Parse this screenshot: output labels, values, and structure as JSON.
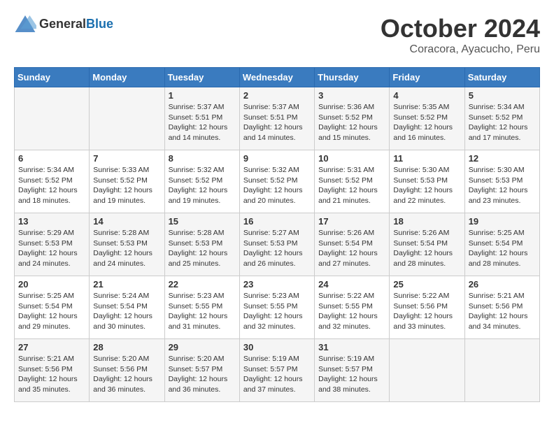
{
  "header": {
    "logo_general": "General",
    "logo_blue": "Blue",
    "month_title": "October 2024",
    "subtitle": "Coracora, Ayacucho, Peru"
  },
  "weekdays": [
    "Sunday",
    "Monday",
    "Tuesday",
    "Wednesday",
    "Thursday",
    "Friday",
    "Saturday"
  ],
  "weeks": [
    [
      {
        "day": "",
        "sunrise": "",
        "sunset": "",
        "daylight": ""
      },
      {
        "day": "",
        "sunrise": "",
        "sunset": "",
        "daylight": ""
      },
      {
        "day": "1",
        "sunrise": "Sunrise: 5:37 AM",
        "sunset": "Sunset: 5:51 PM",
        "daylight": "Daylight: 12 hours and 14 minutes."
      },
      {
        "day": "2",
        "sunrise": "Sunrise: 5:37 AM",
        "sunset": "Sunset: 5:51 PM",
        "daylight": "Daylight: 12 hours and 14 minutes."
      },
      {
        "day": "3",
        "sunrise": "Sunrise: 5:36 AM",
        "sunset": "Sunset: 5:52 PM",
        "daylight": "Daylight: 12 hours and 15 minutes."
      },
      {
        "day": "4",
        "sunrise": "Sunrise: 5:35 AM",
        "sunset": "Sunset: 5:52 PM",
        "daylight": "Daylight: 12 hours and 16 minutes."
      },
      {
        "day": "5",
        "sunrise": "Sunrise: 5:34 AM",
        "sunset": "Sunset: 5:52 PM",
        "daylight": "Daylight: 12 hours and 17 minutes."
      }
    ],
    [
      {
        "day": "6",
        "sunrise": "Sunrise: 5:34 AM",
        "sunset": "Sunset: 5:52 PM",
        "daylight": "Daylight: 12 hours and 18 minutes."
      },
      {
        "day": "7",
        "sunrise": "Sunrise: 5:33 AM",
        "sunset": "Sunset: 5:52 PM",
        "daylight": "Daylight: 12 hours and 19 minutes."
      },
      {
        "day": "8",
        "sunrise": "Sunrise: 5:32 AM",
        "sunset": "Sunset: 5:52 PM",
        "daylight": "Daylight: 12 hours and 19 minutes."
      },
      {
        "day": "9",
        "sunrise": "Sunrise: 5:32 AM",
        "sunset": "Sunset: 5:52 PM",
        "daylight": "Daylight: 12 hours and 20 minutes."
      },
      {
        "day": "10",
        "sunrise": "Sunrise: 5:31 AM",
        "sunset": "Sunset: 5:52 PM",
        "daylight": "Daylight: 12 hours and 21 minutes."
      },
      {
        "day": "11",
        "sunrise": "Sunrise: 5:30 AM",
        "sunset": "Sunset: 5:53 PM",
        "daylight": "Daylight: 12 hours and 22 minutes."
      },
      {
        "day": "12",
        "sunrise": "Sunrise: 5:30 AM",
        "sunset": "Sunset: 5:53 PM",
        "daylight": "Daylight: 12 hours and 23 minutes."
      }
    ],
    [
      {
        "day": "13",
        "sunrise": "Sunrise: 5:29 AM",
        "sunset": "Sunset: 5:53 PM",
        "daylight": "Daylight: 12 hours and 24 minutes."
      },
      {
        "day": "14",
        "sunrise": "Sunrise: 5:28 AM",
        "sunset": "Sunset: 5:53 PM",
        "daylight": "Daylight: 12 hours and 24 minutes."
      },
      {
        "day": "15",
        "sunrise": "Sunrise: 5:28 AM",
        "sunset": "Sunset: 5:53 PM",
        "daylight": "Daylight: 12 hours and 25 minutes."
      },
      {
        "day": "16",
        "sunrise": "Sunrise: 5:27 AM",
        "sunset": "Sunset: 5:53 PM",
        "daylight": "Daylight: 12 hours and 26 minutes."
      },
      {
        "day": "17",
        "sunrise": "Sunrise: 5:26 AM",
        "sunset": "Sunset: 5:54 PM",
        "daylight": "Daylight: 12 hours and 27 minutes."
      },
      {
        "day": "18",
        "sunrise": "Sunrise: 5:26 AM",
        "sunset": "Sunset: 5:54 PM",
        "daylight": "Daylight: 12 hours and 28 minutes."
      },
      {
        "day": "19",
        "sunrise": "Sunrise: 5:25 AM",
        "sunset": "Sunset: 5:54 PM",
        "daylight": "Daylight: 12 hours and 28 minutes."
      }
    ],
    [
      {
        "day": "20",
        "sunrise": "Sunrise: 5:25 AM",
        "sunset": "Sunset: 5:54 PM",
        "daylight": "Daylight: 12 hours and 29 minutes."
      },
      {
        "day": "21",
        "sunrise": "Sunrise: 5:24 AM",
        "sunset": "Sunset: 5:54 PM",
        "daylight": "Daylight: 12 hours and 30 minutes."
      },
      {
        "day": "22",
        "sunrise": "Sunrise: 5:23 AM",
        "sunset": "Sunset: 5:55 PM",
        "daylight": "Daylight: 12 hours and 31 minutes."
      },
      {
        "day": "23",
        "sunrise": "Sunrise: 5:23 AM",
        "sunset": "Sunset: 5:55 PM",
        "daylight": "Daylight: 12 hours and 32 minutes."
      },
      {
        "day": "24",
        "sunrise": "Sunrise: 5:22 AM",
        "sunset": "Sunset: 5:55 PM",
        "daylight": "Daylight: 12 hours and 32 minutes."
      },
      {
        "day": "25",
        "sunrise": "Sunrise: 5:22 AM",
        "sunset": "Sunset: 5:56 PM",
        "daylight": "Daylight: 12 hours and 33 minutes."
      },
      {
        "day": "26",
        "sunrise": "Sunrise: 5:21 AM",
        "sunset": "Sunset: 5:56 PM",
        "daylight": "Daylight: 12 hours and 34 minutes."
      }
    ],
    [
      {
        "day": "27",
        "sunrise": "Sunrise: 5:21 AM",
        "sunset": "Sunset: 5:56 PM",
        "daylight": "Daylight: 12 hours and 35 minutes."
      },
      {
        "day": "28",
        "sunrise": "Sunrise: 5:20 AM",
        "sunset": "Sunset: 5:56 PM",
        "daylight": "Daylight: 12 hours and 36 minutes."
      },
      {
        "day": "29",
        "sunrise": "Sunrise: 5:20 AM",
        "sunset": "Sunset: 5:57 PM",
        "daylight": "Daylight: 12 hours and 36 minutes."
      },
      {
        "day": "30",
        "sunrise": "Sunrise: 5:19 AM",
        "sunset": "Sunset: 5:57 PM",
        "daylight": "Daylight: 12 hours and 37 minutes."
      },
      {
        "day": "31",
        "sunrise": "Sunrise: 5:19 AM",
        "sunset": "Sunset: 5:57 PM",
        "daylight": "Daylight: 12 hours and 38 minutes."
      },
      {
        "day": "",
        "sunrise": "",
        "sunset": "",
        "daylight": ""
      },
      {
        "day": "",
        "sunrise": "",
        "sunset": "",
        "daylight": ""
      }
    ]
  ]
}
